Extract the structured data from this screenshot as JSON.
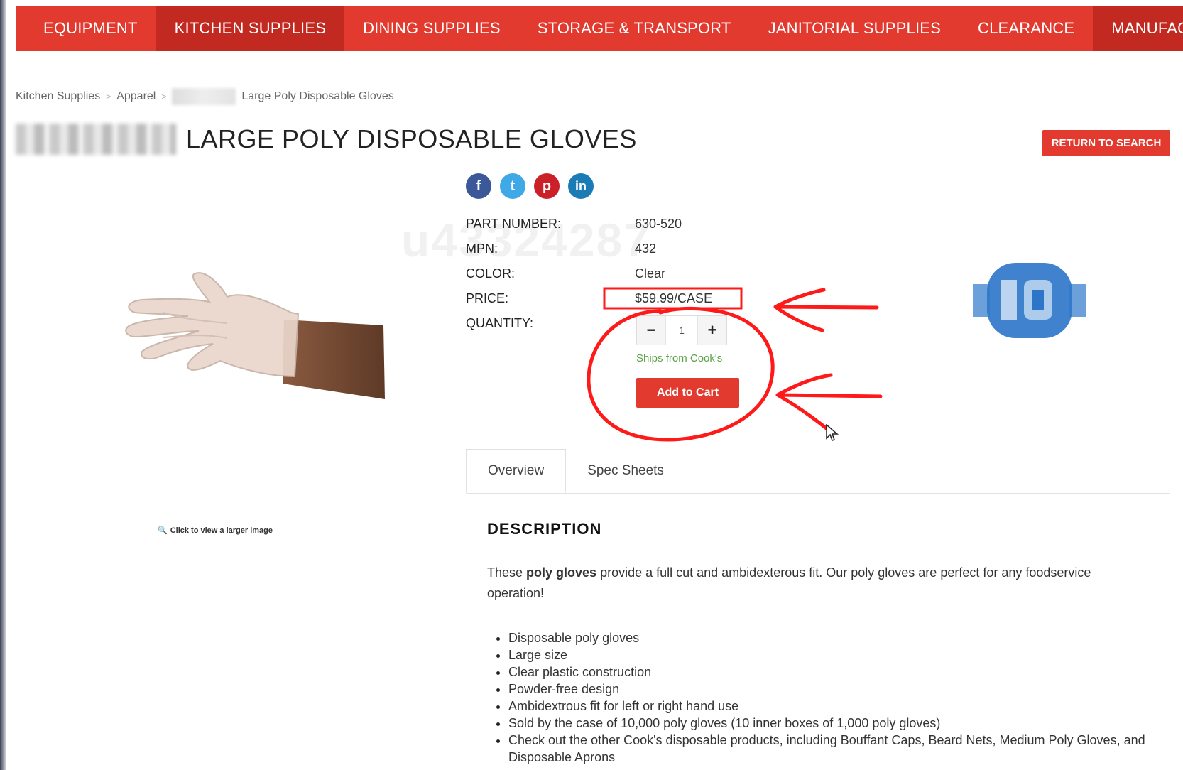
{
  "nav": {
    "items": [
      {
        "label": "EQUIPMENT",
        "active": false
      },
      {
        "label": "KITCHEN SUPPLIES",
        "active": true
      },
      {
        "label": "DINING SUPPLIES",
        "active": false
      },
      {
        "label": "STORAGE & TRANSPORT",
        "active": false
      },
      {
        "label": "JANITORIAL SUPPLIES",
        "active": false
      },
      {
        "label": "CLEARANCE",
        "active": false
      },
      {
        "label": "MANUFACTURER",
        "active": true
      }
    ]
  },
  "breadcrumb": {
    "items": [
      "Kitchen Supplies",
      "Apparel",
      "Large Poly Disposable Gloves"
    ],
    "separator": ">"
  },
  "product": {
    "title": "LARGE POLY DISPOSABLE GLOVES",
    "return_label": "RETURN TO SEARCH",
    "specs": [
      {
        "label": "PART NUMBER:",
        "value": "630-520"
      },
      {
        "label": "MPN:",
        "value": "432"
      },
      {
        "label": "COLOR:",
        "value": "Clear"
      },
      {
        "label": "PRICE:",
        "value": "$59.99/CASE"
      },
      {
        "label": "QUANTITY:",
        "value": ""
      }
    ],
    "quantity": "1",
    "ships_from": "Ships from Cook's",
    "add_to_cart": "Add to Cart",
    "larger_image_link": "Click to view a larger image",
    "watermark": "u43324287"
  },
  "social": {
    "icons": [
      "facebook-icon",
      "twitter-icon",
      "pinterest-icon",
      "linkedin-icon"
    ],
    "glyphs": [
      "f",
      "t",
      "p",
      "in"
    ]
  },
  "tabs": [
    {
      "label": "Overview",
      "active": true
    },
    {
      "label": "Spec Sheets",
      "active": false
    }
  ],
  "description": {
    "heading": "DESCRIPTION",
    "intro_before": "These ",
    "intro_bold": "poly gloves",
    "intro_after": " provide a full cut and ambidexterous fit. Our poly gloves are perfect for any foodservice operation!",
    "bullets": [
      "Disposable poly gloves",
      "Large size",
      "Clear plastic construction",
      "Powder-free design",
      "Ambidextrous fit for left or right hand use",
      "Sold by the case of 10,000 poly gloves (10 inner boxes of 1,000 poly gloves)",
      "Check out the other Cook's disposable products, including Bouffant Caps, Beard Nets, Medium Poly Gloves, and Disposable Aprons"
    ]
  },
  "colors": {
    "brand_red": "#e23a2f",
    "brand_red_dark": "#c22a21",
    "annotation_red": "#ff1a1a",
    "ships_green": "#5ba045"
  }
}
